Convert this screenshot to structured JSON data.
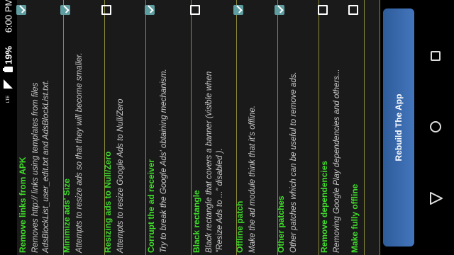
{
  "status_bar": {
    "time": "6:00 PM",
    "battery_pct": "19%",
    "network": "LTE",
    "volte": "VoLTE"
  },
  "options": [
    {
      "title": "Remove links from APK",
      "description": "Removes http:// links using templates from files AdsBlockList_user_edit.txt and AdsBlockList.txt.",
      "checked": true
    },
    {
      "title": "Minimize ads' Size",
      "description": "Attempts to resize ads so that they will become smaller.",
      "checked": true
    },
    {
      "title": "Resizing ads to Null/Zero",
      "description": "Attempts to resize Google Ads to Null/Zero",
      "checked": false
    },
    {
      "title": "Corrupt the ad receiver",
      "description": "Try to break the Google Ads' obtaining mechanism.",
      "checked": true
    },
    {
      "title": "Black rectangle",
      "description": "Black rectangle that covers a banner (visible when \"Resize Ads to ...\" disabled ).",
      "checked": false
    },
    {
      "title": "Offline patch",
      "description": "Make the ad module think that it's offline.",
      "checked": true
    },
    {
      "title": "Other patches",
      "description": "Other patches which can be useful to remove ads.",
      "checked": true
    },
    {
      "title": "Remove dependencies",
      "description": "Removing Google Play dependencies and others...",
      "checked": false
    },
    {
      "title": "Make fully offline",
      "description": "",
      "checked": false
    }
  ],
  "rebuild_button": {
    "label": "Rebuild The App"
  },
  "colors": {
    "title": "#3fdc2a",
    "description": "#c8c8c8",
    "checkbox_on": "#5f9ea0",
    "button": "#3a6aad",
    "divider": "#8a8a3a"
  }
}
